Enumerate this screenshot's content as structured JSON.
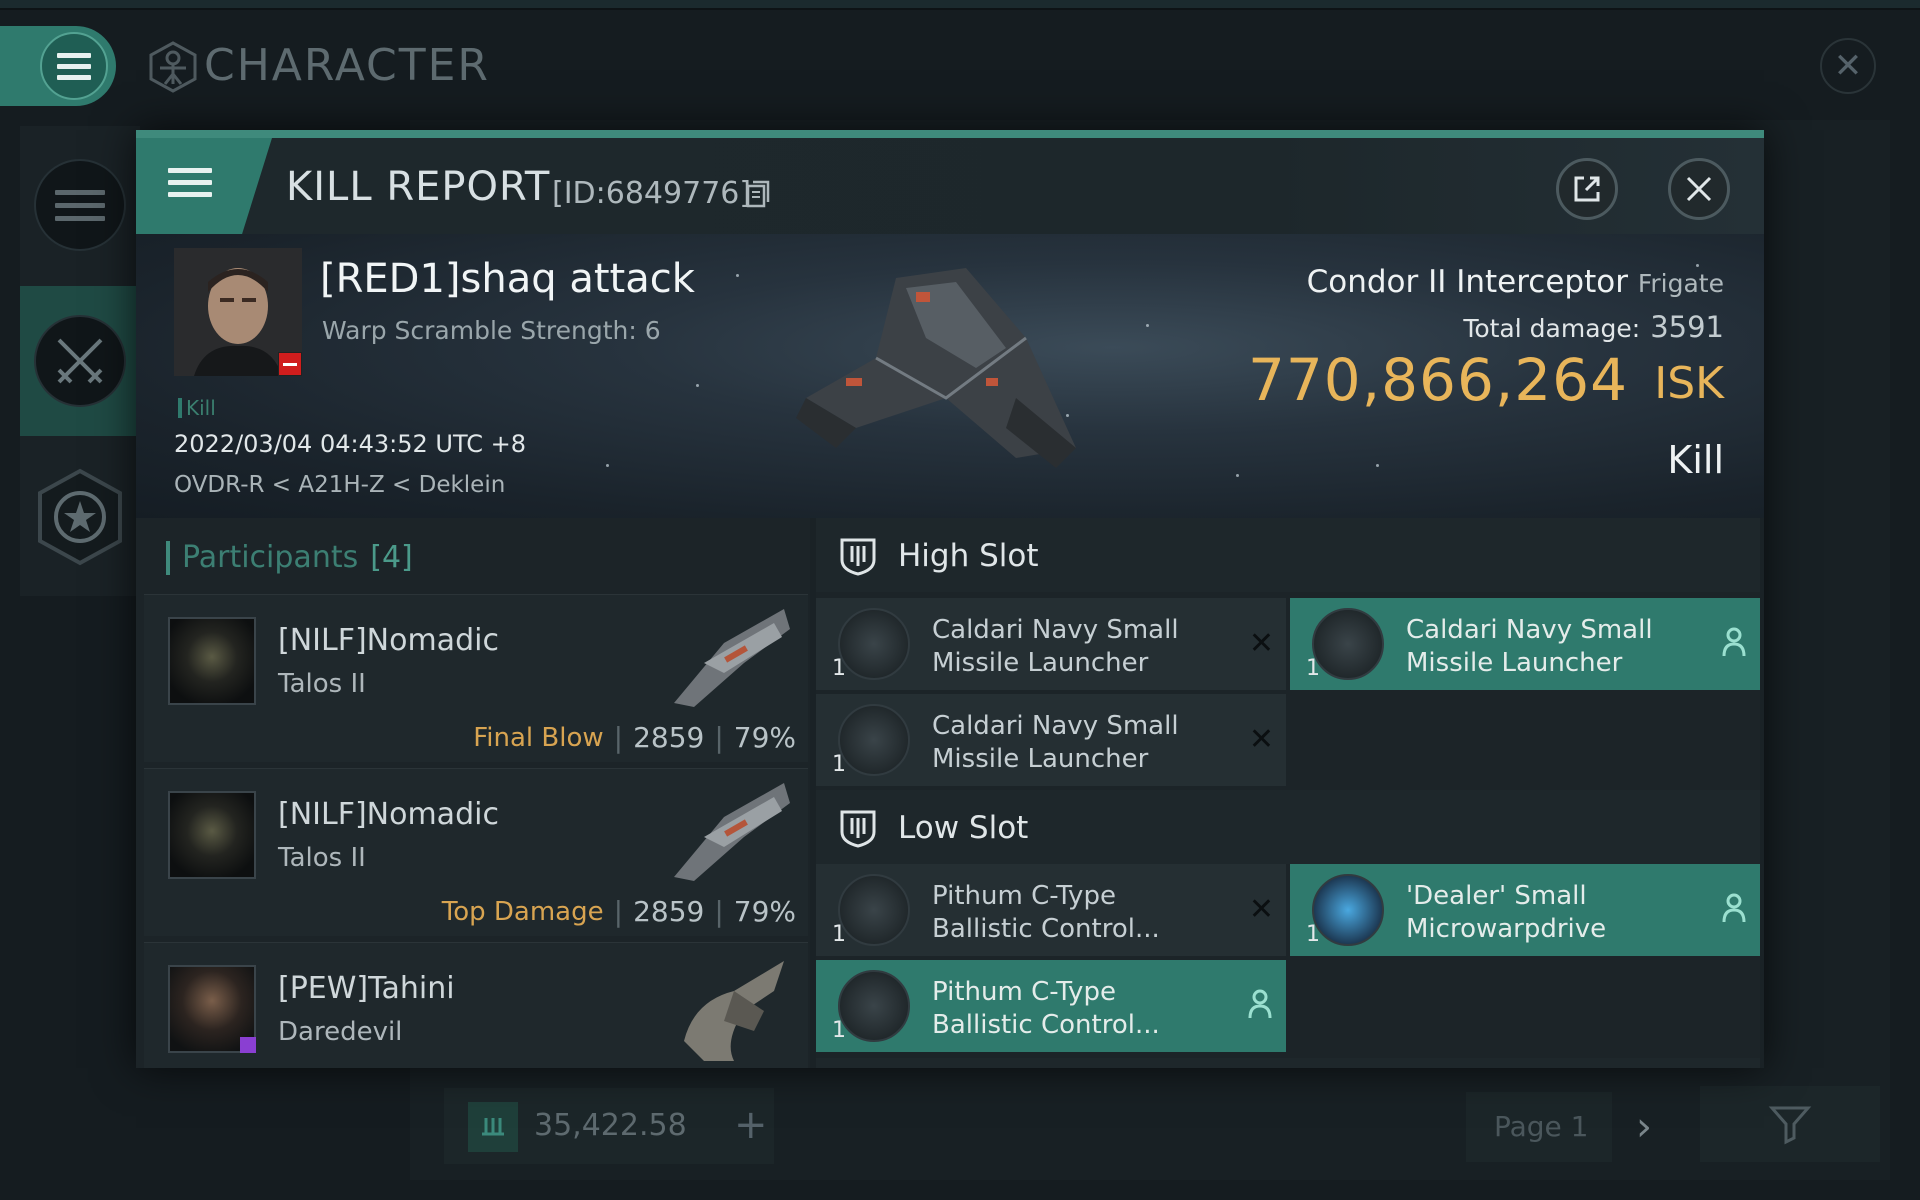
{
  "background": {
    "title": "CHARACTER",
    "wallet": "35,422.58",
    "page_label": "Page 1"
  },
  "modal": {
    "title": "KILL REPORT",
    "id_label": "[ID:6849776]"
  },
  "victim": {
    "name": "[RED1]shaq attack",
    "warp": "Warp Scramble Strength: 6",
    "kill_tag": "Kill",
    "date": "2022/03/04 04:43:52 UTC +8",
    "location": "OVDR-R < A21H-Z < Deklein",
    "ship_name": "Condor II Interceptor",
    "ship_class": "Frigate",
    "total_damage_label": "Total damage:",
    "total_damage": "3591",
    "isk_value": "770,866,264",
    "isk_unit": "ISK",
    "result": "Kill"
  },
  "participants": {
    "label": "Participants",
    "count": "[4]",
    "rows": [
      {
        "name": "[NILF]Nomadic",
        "ship": "Talos II",
        "label": "Final Blow",
        "damage": "2859",
        "pct": "79%"
      },
      {
        "name": "[NILF]Nomadic",
        "ship": "Talos II",
        "label": "Top Damage",
        "damage": "2859",
        "pct": "79%"
      },
      {
        "name": "[PEW]Tahini",
        "ship": "Daredevil"
      }
    ]
  },
  "fittings": {
    "high_slot": "High Slot",
    "low_slot": "Low Slot",
    "items": [
      {
        "name1": "Caldari Navy Small",
        "name2": "Missile Launcher",
        "qty": "1",
        "state": "destroyed"
      },
      {
        "name1": "Caldari Navy Small",
        "name2": "Missile Launcher",
        "qty": "1",
        "state": "dropped"
      },
      {
        "name1": "Caldari Navy Small",
        "name2": "Missile Launcher",
        "qty": "1",
        "state": "destroyed"
      },
      {
        "name1": "Pithum C-Type",
        "name2": "Ballistic Control...",
        "qty": "1",
        "state": "destroyed"
      },
      {
        "name1": "'Dealer' Small",
        "name2": "Microwarpdrive",
        "qty": "1",
        "state": "dropped"
      },
      {
        "name1": "Pithum C-Type",
        "name2": "Ballistic Control...",
        "qty": "1",
        "state": "dropped"
      }
    ]
  },
  "colors": {
    "accent": "#2f7a6d",
    "isk": "#e8b55a",
    "final_blow": "#d8a451"
  }
}
